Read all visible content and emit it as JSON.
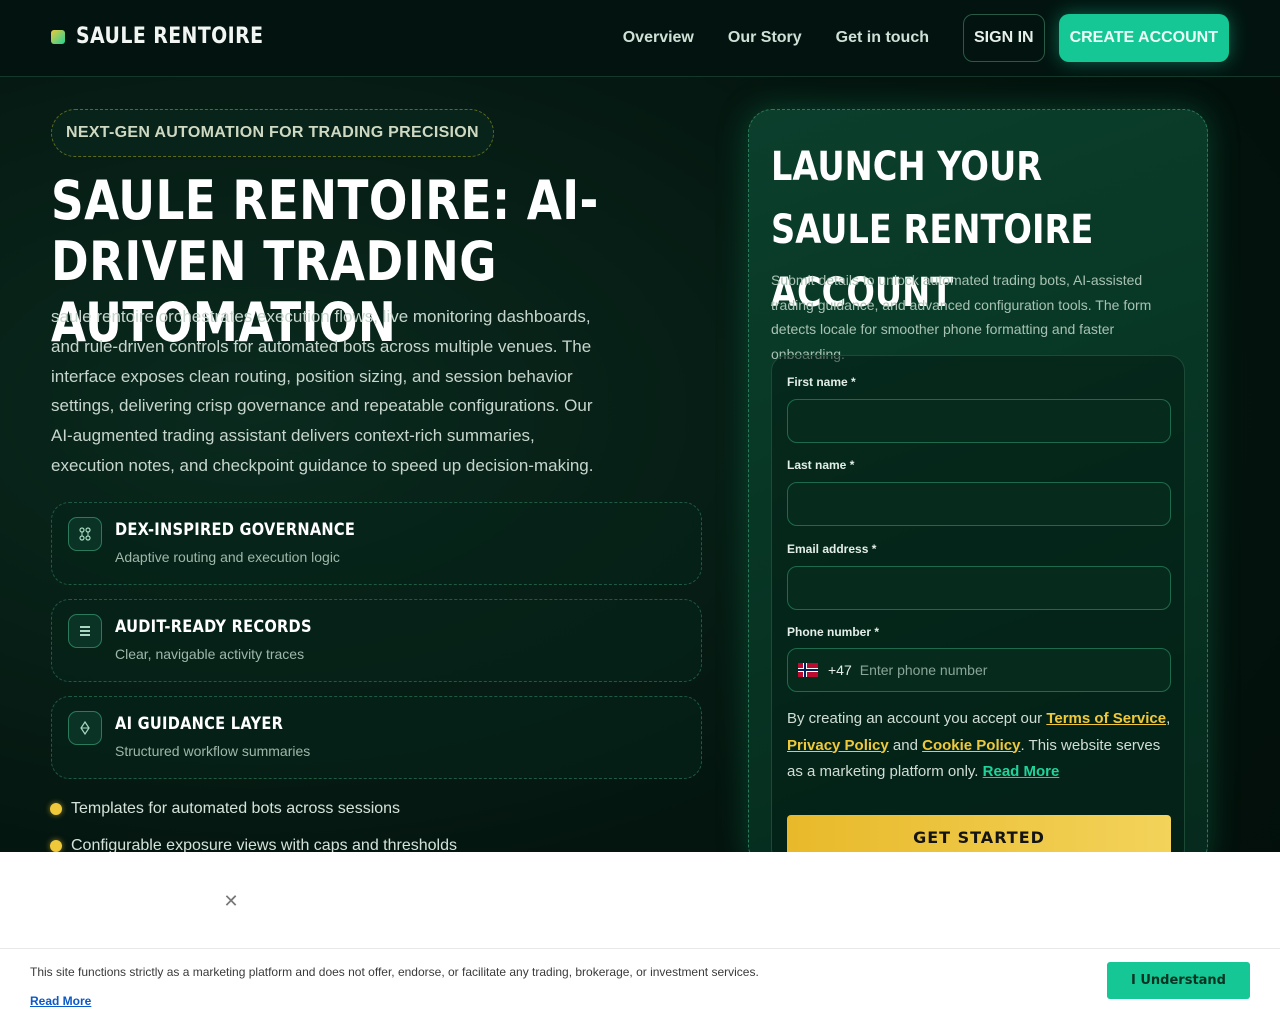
{
  "header": {
    "brand": "SAULE RENTOIRE",
    "nav": [
      "Overview",
      "Our Story",
      "Get in touch"
    ],
    "sign_in": "SIGN IN",
    "create_account": "CREATE ACCOUNT"
  },
  "hero": {
    "badge": "NEXT-GEN AUTOMATION FOR TRADING PRECISION",
    "title": "SAULE RENTOIRE: AI-DRIVEN TRADING AUTOMATION",
    "description": "saule rentoire orchestrates execution flows, live monitoring dashboards, and rule-driven controls for automated bots across multiple venues. The interface exposes clean routing, position sizing, and session behavior settings, delivering crisp governance and repeatable configurations. Our AI-augmented trading assistant delivers context-rich summaries, execution notes, and checkpoint guidance to speed up decision-making."
  },
  "features": [
    {
      "icon": "nodes-icon",
      "title": "DEX-INSPIRED GOVERNANCE",
      "subtitle": "Adaptive routing and execution logic"
    },
    {
      "icon": "records-icon",
      "title": "AUDIT-READY RECORDS",
      "subtitle": "Clear, navigable activity traces"
    },
    {
      "icon": "diamond-icon",
      "title": "AI GUIDANCE LAYER",
      "subtitle": "Structured workflow summaries"
    }
  ],
  "bullets": [
    "Templates for automated bots across sessions",
    "Configurable exposure views with caps and thresholds"
  ],
  "form": {
    "title": "LAUNCH YOUR SAULE RENTOIRE ACCOUNT",
    "description": "Submit details to unlock automated trading bots, AI-assisted trading guidance, and advanced configuration tools. The form detects locale for smoother phone formatting and faster onboarding.",
    "first_name_label": "First name *",
    "first_name_value": "",
    "last_name_label": "Last name *",
    "last_name_value": "",
    "email_label": "Email address *",
    "email_value": "",
    "phone_label": "Phone number *",
    "phone_dial_code": "+47",
    "phone_placeholder": "Enter phone number",
    "phone_value": "",
    "legal_prefix": "By creating an account you accept our",
    "terms_link": "Terms of Service",
    "comma": ",",
    "privacy_link": "Privacy Policy",
    "and_text": "and",
    "cookie_link": "Cookie Policy",
    "legal_suffix": ". This website serves as a marketing platform only.",
    "read_more": "Read More",
    "submit": "GET STARTED"
  },
  "cookie": {
    "close_icon": "close-icon",
    "text": "This site functions strictly as a marketing platform and does not offer, endorse, or facilitate any trading, brokerage, or investment services.",
    "read_more": "Read More",
    "accept": "I Understand"
  },
  "colors": {
    "accent": "#15c795",
    "gold": "#f0c93a",
    "background": "#04150f"
  }
}
